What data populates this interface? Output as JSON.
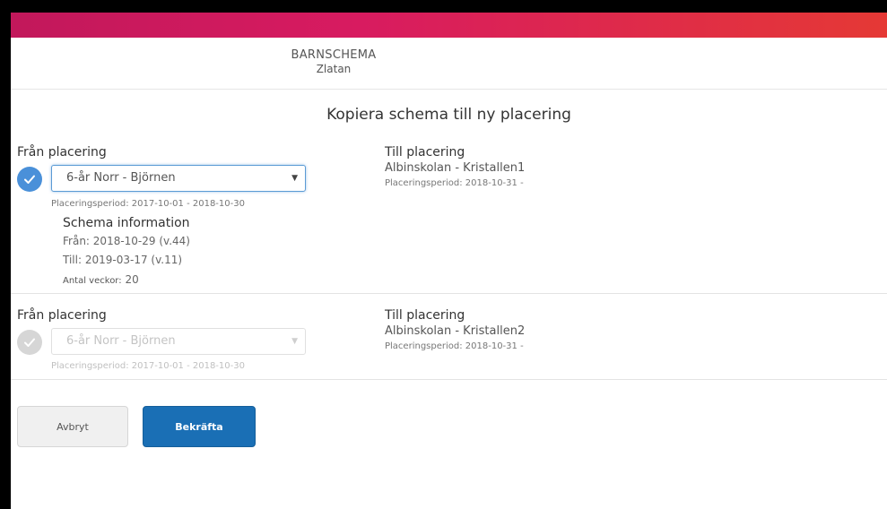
{
  "header": {
    "app_name": "BARNSCHEMA",
    "child_name": "Zlatan"
  },
  "page_title": "Kopiera schema till ny placering",
  "rows": [
    {
      "from_label": "Från placering",
      "from_value": "6-år Norr - Björnen",
      "from_period": "Placeringsperiod: 2017-10-01 - 2018-10-30",
      "to_label": "Till placering",
      "to_value": "Albinskolan - Kristallen1",
      "to_period": "Placeringsperiod: 2018-10-31 -",
      "selected": true,
      "schema": {
        "title": "Schema information",
        "fran_label": "Från:",
        "fran_value": "2018-10-29 (v.44)",
        "till_label": "Till:",
        "till_value": "2019-03-17 (v.11)",
        "weeks_label": "Antal veckor:",
        "weeks_value": "20"
      }
    },
    {
      "from_label": "Från placering",
      "from_value": "6-år Norr - Björnen",
      "from_period": "Placeringsperiod: 2017-10-01 - 2018-10-30",
      "to_label": "Till placering",
      "to_value": "Albinskolan - Kristallen2",
      "to_period": "Placeringsperiod: 2018-10-31 -",
      "selected": false
    }
  ],
  "buttons": {
    "cancel": "Avbryt",
    "confirm": "Bekräfta"
  },
  "colors": {
    "brand_gradient_start": "#c2185b",
    "brand_gradient_end": "#e53935",
    "accent_blue": "#4a90d9",
    "confirm_blue": "#1a6fb5"
  },
  "icons": {
    "check": "check-icon",
    "dropdown": "chevron-down-icon"
  }
}
